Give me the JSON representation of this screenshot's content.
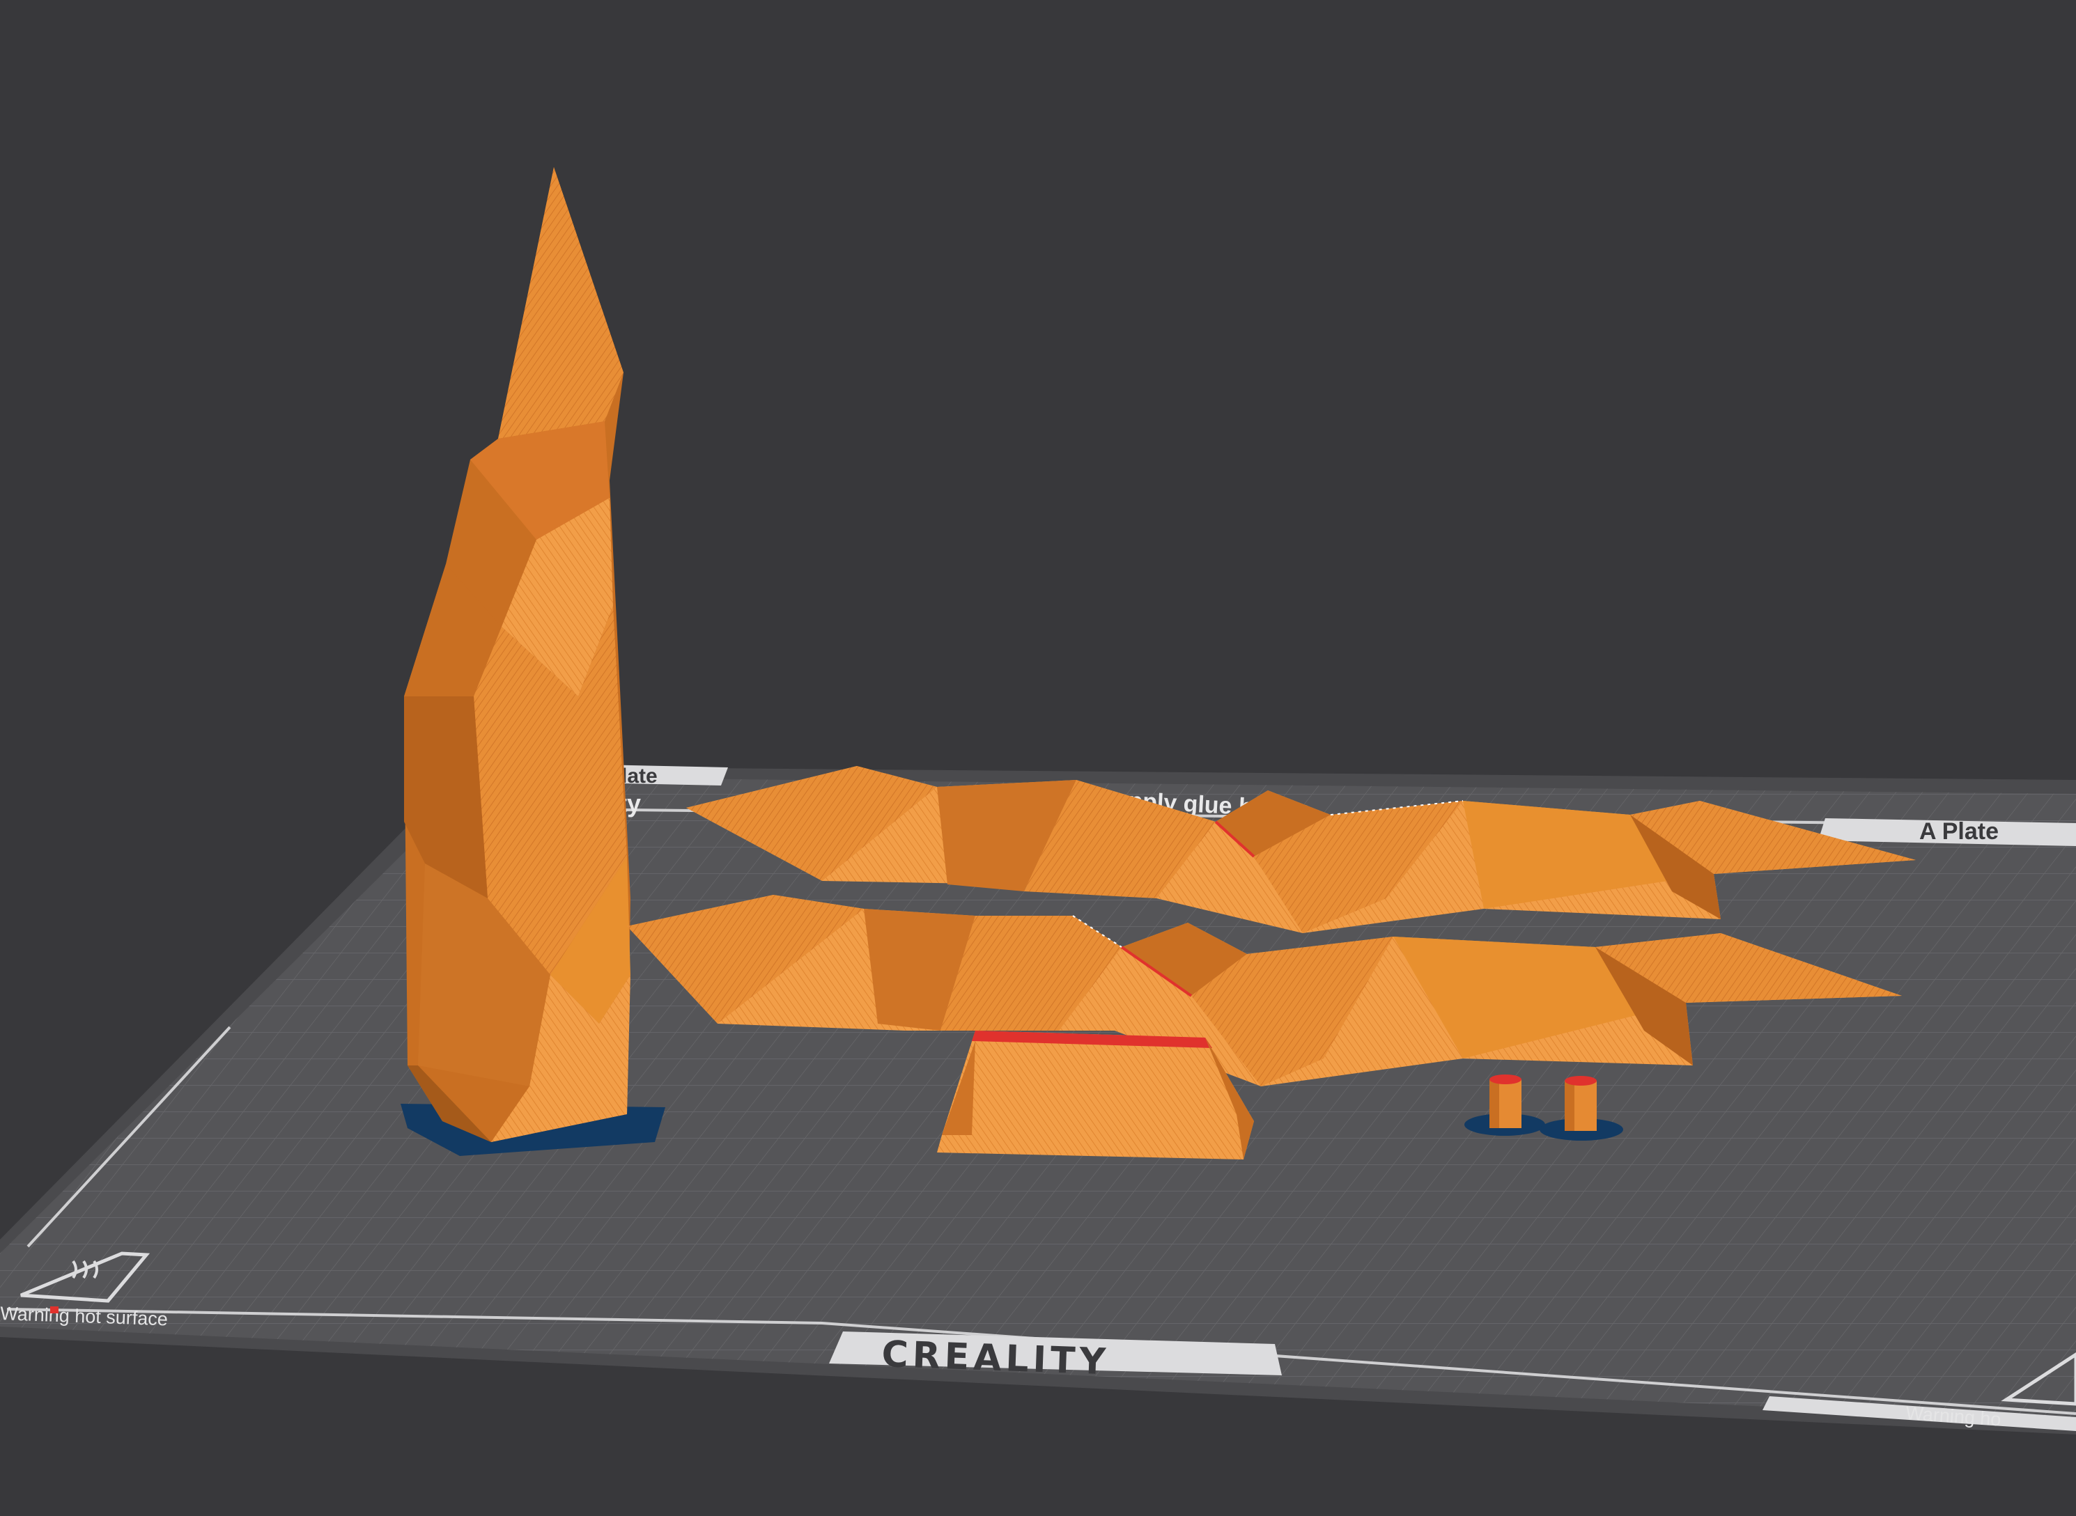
{
  "scene": {
    "bed_brand": "CREALITY",
    "bed_left_label": "Plate",
    "bed_top_partial": "lity",
    "bed_top_text": "apply glue before",
    "bed_right_label": "A Plate",
    "warning_left": "Warning hot surface",
    "warning_right": "Warning ho"
  },
  "colors": {
    "background": "#38383b",
    "bed": "#545457",
    "grid": "#6a6a6d",
    "model": "#e58a33",
    "model_shade": "#c96f22",
    "model_light": "#f2a14a",
    "brim": "#123a63",
    "overhang": "#e0322d"
  },
  "icons": [
    "hot-surface-warning-icon",
    "hot-surface-warning-icon-right"
  ]
}
